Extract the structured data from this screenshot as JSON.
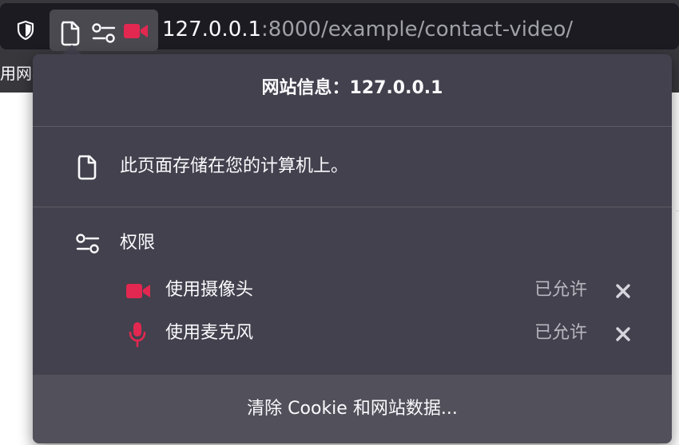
{
  "toolbar": {
    "url_host": "127.0.0.1",
    "url_rest": ":8000/example/contact-video/",
    "icons": {
      "tracking": "shield-icon",
      "page": "page-icon",
      "permissions": "permissions-icon",
      "camera": "camera-icon"
    }
  },
  "bookmarks": {
    "partial_label": "用网址"
  },
  "panel": {
    "title": "网站信息：127.0.0.1",
    "storage_text": "此页面存储在您的计算机上。",
    "permissions_heading": "权限",
    "permissions": [
      {
        "label": "使用摄像头",
        "status": "已允许",
        "icon": "camera-icon"
      },
      {
        "label": "使用麦克风",
        "status": "已允许",
        "icon": "microphone-icon"
      }
    ],
    "clear_button": "清除 Cookie 和网站数据..."
  },
  "colors": {
    "toolbar_bg": "#38373c",
    "urlbar_bg": "#1c1b22",
    "panel_bg": "#42414d",
    "footer_bg": "#52515b",
    "accent_red": "#e22850",
    "text": "#fbfbfe",
    "muted_text": "#b8b7bf"
  }
}
